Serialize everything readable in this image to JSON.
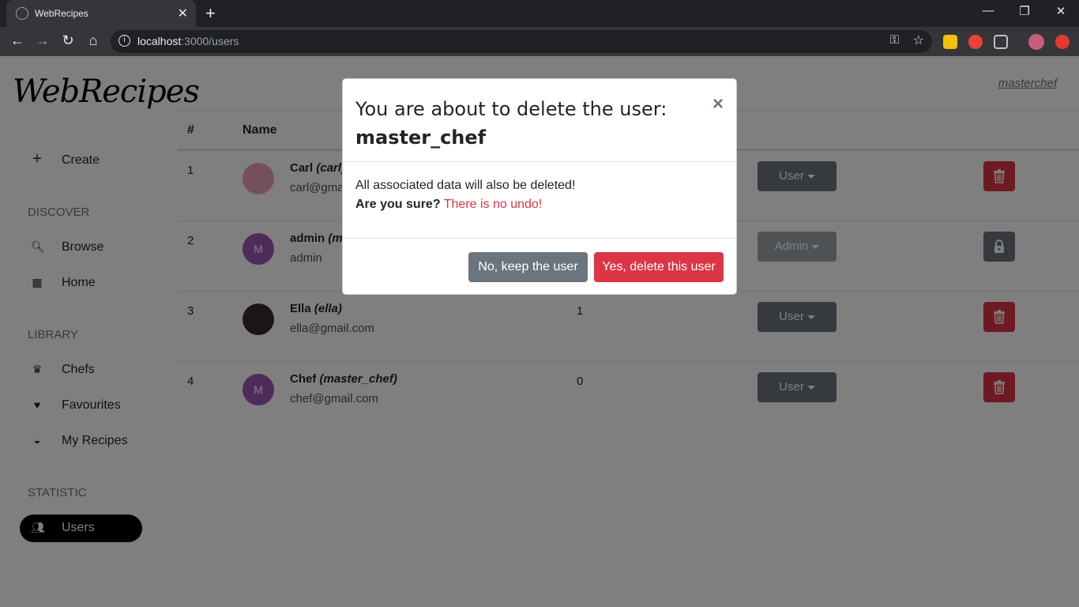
{
  "browser": {
    "tab_title": "WebRecipes",
    "url_host": "localhost",
    "url_path": ":3000/users"
  },
  "sidebar": {
    "logo": "WebRecipes",
    "create_label": "Create",
    "sections": {
      "discover": "DISCOVER",
      "library": "LIBRARY",
      "statistic": "STATISTIC"
    },
    "items": {
      "browse": "Browse",
      "home": "Home",
      "chefs": "Chefs",
      "favourites": "Favourites",
      "my_recipes": "My Recipes",
      "users": "Users"
    }
  },
  "header": {
    "username": "masterchef"
  },
  "table": {
    "columns": [
      "#",
      "Name"
    ],
    "rows": [
      {
        "index": "1",
        "name": "Carl",
        "handle": "(carl)",
        "email": "carl@gmail.com",
        "count": "",
        "role": "User",
        "role_disabled": false,
        "locked": false,
        "avatar_color": "#e8a0b4",
        "avatar_initial": ""
      },
      {
        "index": "2",
        "name": "admin",
        "handle": "(m",
        "email": "admin",
        "count": "",
        "role": "Admin",
        "role_disabled": true,
        "locked": true,
        "avatar_color": "#9b59b6",
        "avatar_initial": "M"
      },
      {
        "index": "3",
        "name": "Ella",
        "handle": "(ella)",
        "email": "ella@gmail.com",
        "count": "1",
        "role": "User",
        "role_disabled": false,
        "locked": false,
        "avatar_color": "#3a2b2b",
        "avatar_initial": ""
      },
      {
        "index": "4",
        "name": "Chef",
        "handle": "(master_chef)",
        "email": "chef@gmail.com",
        "count": "0",
        "role": "User",
        "role_disabled": false,
        "locked": false,
        "avatar_color": "#9b59b6",
        "avatar_initial": "M"
      }
    ]
  },
  "modal": {
    "title_prefix": "You are about to delete the user:",
    "title_user": "master_chef",
    "body_line1": "All associated data will also be deleted!",
    "body_bold": "Are you sure?",
    "body_warning": "There is no undo!",
    "close_symbol": "×",
    "keep_label": "No, keep the user",
    "delete_label": "Yes, delete this user"
  },
  "colors": {
    "danger": "#dc3545",
    "secondary": "#6c757d",
    "accent_purple": "#9b59b6"
  }
}
